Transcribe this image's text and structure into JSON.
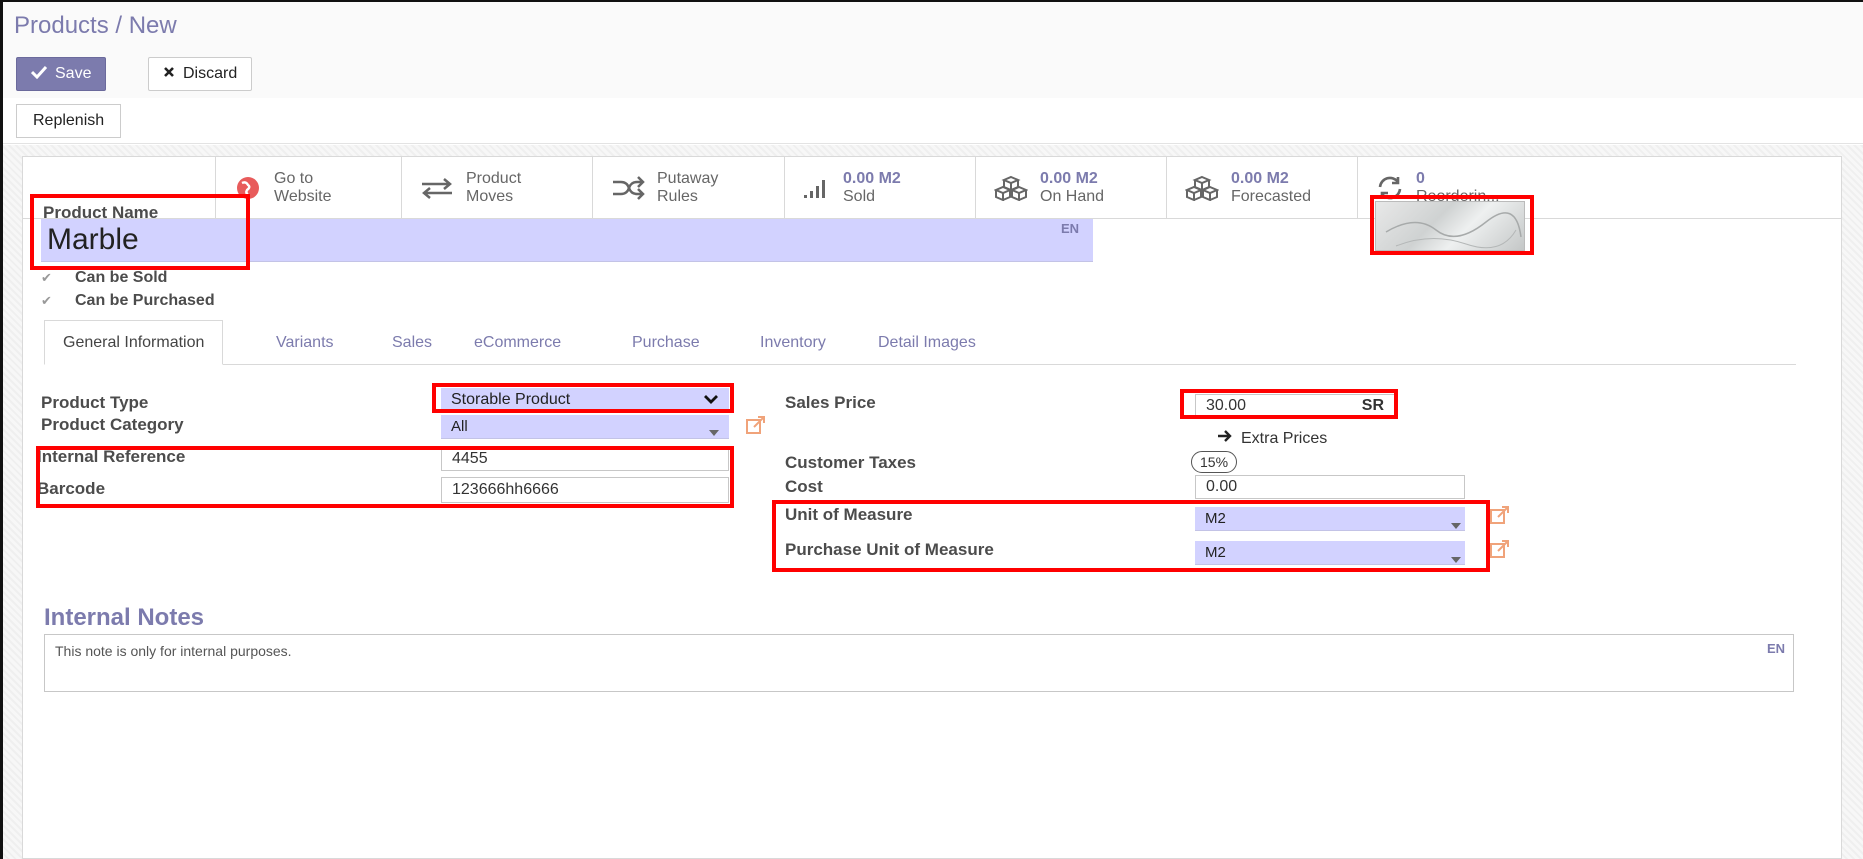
{
  "breadcrumb": "Products / New",
  "buttons": {
    "save": "Save",
    "discard": "Discard",
    "replenish": "Replenish"
  },
  "smart_buttons": [
    {
      "line1": "Go to",
      "line2": "Website",
      "icon": "globe-icon"
    },
    {
      "line1": "Product",
      "line2": "Moves",
      "icon": "exchange-arrows-icon"
    },
    {
      "line1": "Putaway",
      "line2": "Rules",
      "icon": "shuffle-icon"
    },
    {
      "line1": "0.00 M2",
      "line2": "Sold",
      "icon": "bar-chart-icon"
    },
    {
      "line1": "0.00 M2",
      "line2": "On Hand",
      "icon": "cubes-icon"
    },
    {
      "line1": "0.00 M2",
      "line2": "Forecasted",
      "icon": "cubes-icon"
    },
    {
      "line1": "0",
      "line2": "Reorderin...",
      "icon": "refresh-icon"
    }
  ],
  "product": {
    "name_label": "Product Name",
    "name": "Marble",
    "lang": "EN",
    "can_be_sold": "Can be Sold",
    "can_be_purchased": "Can be Purchased"
  },
  "tabs": [
    "General Information",
    "Variants",
    "Sales",
    "eCommerce",
    "Purchase",
    "Inventory",
    "Detail Images"
  ],
  "left_fields": {
    "product_type_label": "Product Type",
    "product_type": "Storable Product",
    "product_category_label": "Product Category",
    "product_category": "All",
    "internal_reference_label": "Internal Reference",
    "internal_reference": "4455",
    "barcode_label": "Barcode",
    "barcode": "123666hh6666"
  },
  "right_fields": {
    "sales_price_label": "Sales Price",
    "sales_price": "30.00",
    "currency": "SR",
    "extra_prices": "Extra Prices",
    "customer_taxes_label": "Customer Taxes",
    "customer_taxes": "15%",
    "cost_label": "Cost",
    "cost": "0.00",
    "uom_label": "Unit of Measure",
    "uom": "M2",
    "purchase_uom_label": "Purchase Unit of Measure",
    "purchase_uom": "M2"
  },
  "notes": {
    "title": "Internal Notes",
    "placeholder": "This note is only for internal purposes.",
    "lang": "EN"
  },
  "colors": {
    "accent": "#7c7bad",
    "field_required": "#d2d2ff",
    "highlight": "#ff0000",
    "link_icon": "#f0a37a"
  }
}
